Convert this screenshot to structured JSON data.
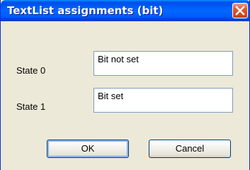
{
  "window": {
    "title": "TextList assignments (bit)"
  },
  "titlebar": {
    "close_icon": "close-icon"
  },
  "form": {
    "state0_label": "State 0",
    "state0_value": "Bit not set",
    "state1_label": "State 1",
    "state1_value": "Bit set"
  },
  "buttons": {
    "ok_label": "OK",
    "cancel_label": "Cancel"
  },
  "colors": {
    "titlebar_blue": "#0058ee",
    "close_red": "#e05a2c",
    "dialog_bg": "#ece9d8"
  }
}
